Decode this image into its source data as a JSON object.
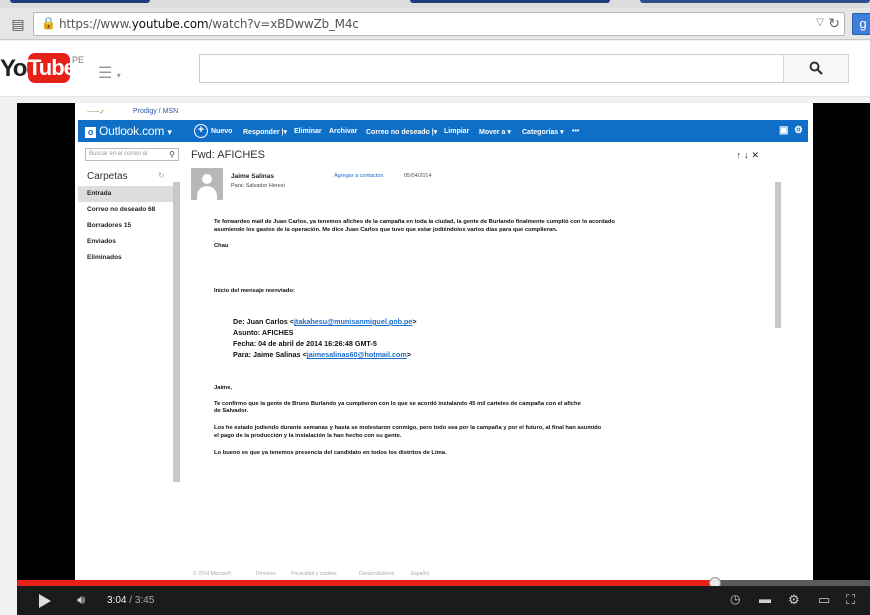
{
  "browser": {
    "url_prefix": "https://www.",
    "url_domain": "youtube.com",
    "url_path": "/watch?v=xBDwwZb_M4c"
  },
  "youtube": {
    "logo_you": "You",
    "logo_tube": "Tube",
    "country": "PE",
    "search_value": "",
    "search_icon": "search-icon"
  },
  "video": {
    "prodigy_label": "Prodigy / MSN",
    "outlook": {
      "app_name": "Outlook.com",
      "toolbar": {
        "new": "Nuevo",
        "reply": "Responder",
        "delete": "Eliminar",
        "archive": "Archivar",
        "junk": "Correo no deseado",
        "clean": "Limpiar",
        "move": "Mover a",
        "categories": "Categorías",
        "more": "•••"
      },
      "search_placeholder": "Buscar en el correo el",
      "folders_title": "Carpetas",
      "folders": [
        {
          "label": "Entrada",
          "selected": true
        },
        {
          "label": "Correo no deseado 68",
          "selected": false
        },
        {
          "label": "Borradores 15",
          "selected": false
        },
        {
          "label": "Enviados",
          "selected": false
        },
        {
          "label": "Eliminados",
          "selected": false
        }
      ],
      "message": {
        "subject": "Fwd: AFICHES",
        "sender": "Jaime Salinas",
        "to": "Para: Salvador Heresi",
        "add_contact": "Agregar a contactos",
        "date": "05/04/2014",
        "body1": "Te forwardeo mail de Juan Carlos, ya tenemos afiches de la campaña en toda la ciudad, la gente de Burlando finalmente cumplió con lo acordado",
        "body1b": "asumiendo los gastos de la operación. Me dice Juan Carlos que tuvo que estar jodiéndolos varios días para que cumplieran.",
        "sign": "Chau",
        "fwd_title": "Inicio del mensaje reenviado:",
        "fwd_from_label": "De:",
        "fwd_from_name": "Juan Carlos <",
        "fwd_from_email": "jtakahesu@munisanmiguel.gob.pe",
        "fwd_from_close": ">",
        "fwd_subject": "Asunto: AFICHES",
        "fwd_date": "Fecha: 04 de abril de 2014 16:26:48 GMT-5",
        "fwd_to_label": "Para:",
        "fwd_to_name": "Jaime Salinas <",
        "fwd_to_email": "jaimesalinas60@hotmail.com",
        "fwd_to_close": ">",
        "b_greet": "Jaime,",
        "b_p1a": "Te confirmo que la gente de Bruno Burlando ya cumplieron con lo que se acordó instalando 45 mil carteles de campaña con el afiche",
        "b_p1b": "de Salvador.",
        "b_p2a": "Los he estado jodiendo durante semanas y hasta se molestaron conmigo, pero todo sea por la campaña y por el futuro, al final han asumido",
        "b_p2b": "el pago de la producción y la instalación la han hecho con su gente.",
        "b_p3": "Lo bueno es que ya tenemos presencia del candidato en todos los distritos de Lima."
      },
      "footer": {
        "copyright": "© 2014 Microsoft",
        "terms": "Términos",
        "privacy": "Privacidad y cookies",
        "dev": "Desarrolladores",
        "lang": "Español"
      }
    }
  },
  "player": {
    "current_time": "3:04",
    "separator": "/",
    "total_time": "3:45",
    "progress": 0.818
  }
}
